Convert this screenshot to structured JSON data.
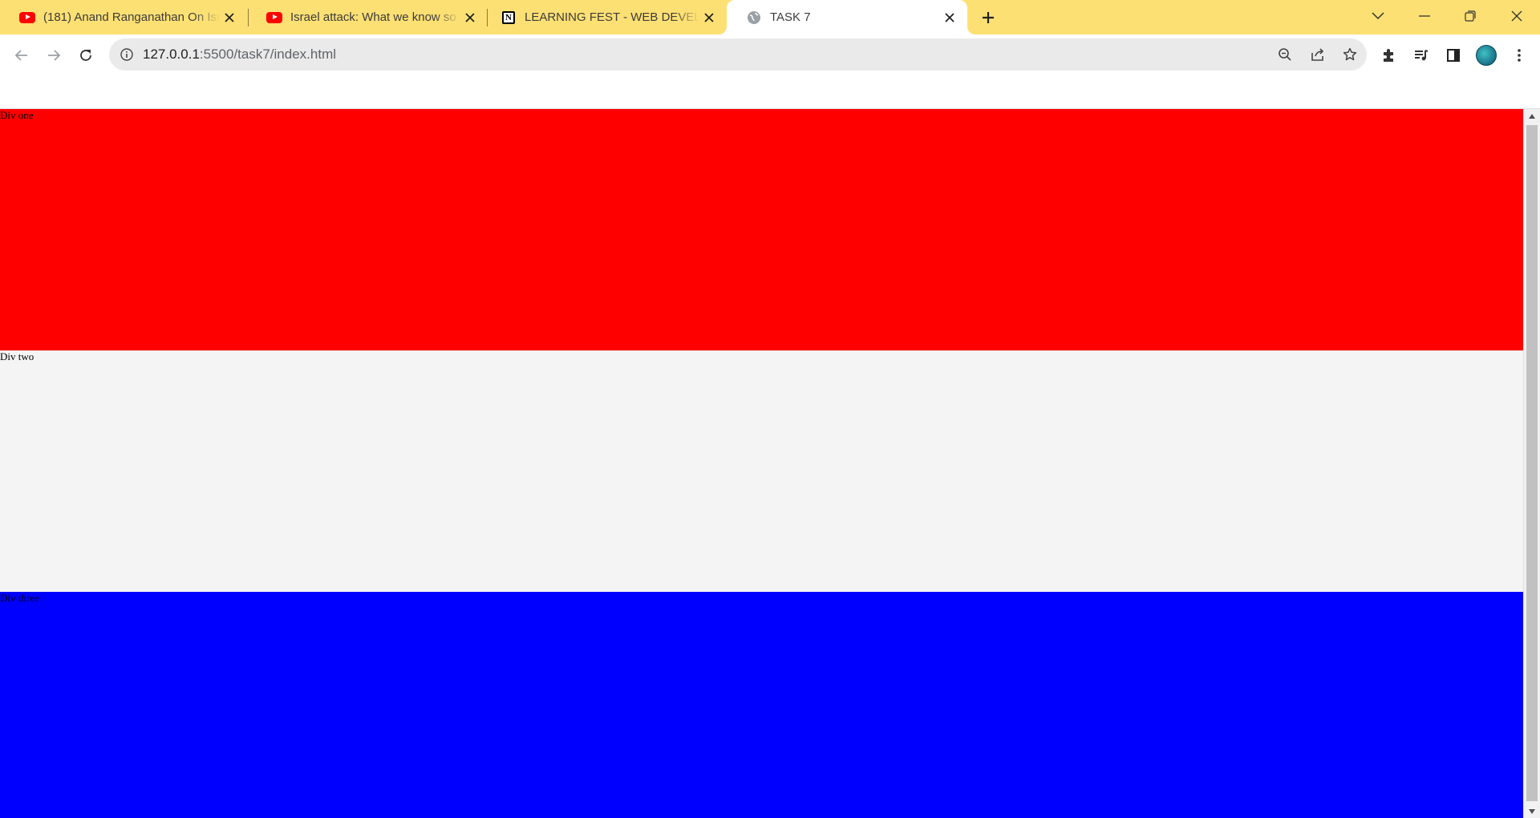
{
  "tabs": [
    {
      "title": "(181) Anand Ranganathan On Isr",
      "favicon": "youtube-icon"
    },
    {
      "title": "Israel attack: What we know so f",
      "favicon": "youtube-icon"
    },
    {
      "title": "LEARNING FEST - WEB DEVELOP",
      "favicon": "notion-icon"
    },
    {
      "title": "TASK 7",
      "favicon": "globe-icon",
      "active": true
    }
  ],
  "omnibox": {
    "host": "127.0.0.1",
    "rest": ":5500/task7/index.html"
  },
  "page": {
    "blocks": [
      {
        "label": "Div one",
        "color": "#ff0000"
      },
      {
        "label": "Div two",
        "color": "#f4f4f4"
      },
      {
        "label": "Div three",
        "color": "#0000ff"
      }
    ]
  },
  "colors": {
    "tabstrip": "#fde073",
    "omnibox": "#eaeaea"
  }
}
